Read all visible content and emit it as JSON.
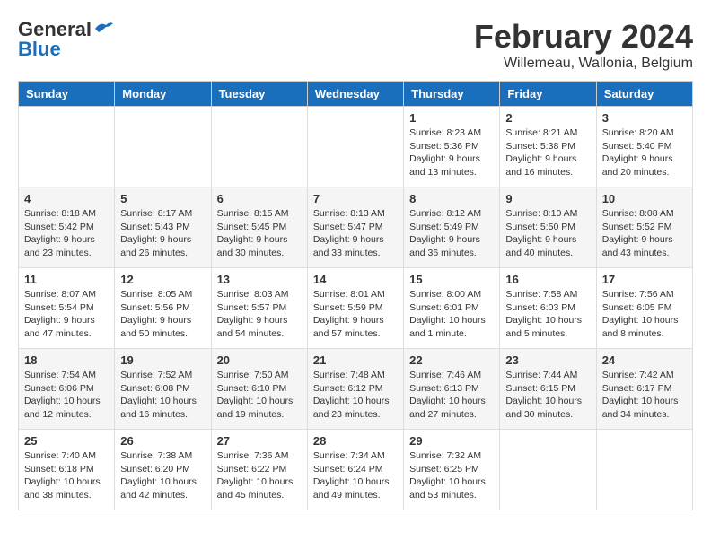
{
  "header": {
    "logo_general": "General",
    "logo_blue": "Blue",
    "month_title": "February 2024",
    "location": "Willemeau, Wallonia, Belgium"
  },
  "weekdays": [
    "Sunday",
    "Monday",
    "Tuesday",
    "Wednesday",
    "Thursday",
    "Friday",
    "Saturday"
  ],
  "weeks": [
    [
      {
        "day": "",
        "info": ""
      },
      {
        "day": "",
        "info": ""
      },
      {
        "day": "",
        "info": ""
      },
      {
        "day": "",
        "info": ""
      },
      {
        "day": "1",
        "info": "Sunrise: 8:23 AM\nSunset: 5:36 PM\nDaylight: 9 hours\nand 13 minutes."
      },
      {
        "day": "2",
        "info": "Sunrise: 8:21 AM\nSunset: 5:38 PM\nDaylight: 9 hours\nand 16 minutes."
      },
      {
        "day": "3",
        "info": "Sunrise: 8:20 AM\nSunset: 5:40 PM\nDaylight: 9 hours\nand 20 minutes."
      }
    ],
    [
      {
        "day": "4",
        "info": "Sunrise: 8:18 AM\nSunset: 5:42 PM\nDaylight: 9 hours\nand 23 minutes."
      },
      {
        "day": "5",
        "info": "Sunrise: 8:17 AM\nSunset: 5:43 PM\nDaylight: 9 hours\nand 26 minutes."
      },
      {
        "day": "6",
        "info": "Sunrise: 8:15 AM\nSunset: 5:45 PM\nDaylight: 9 hours\nand 30 minutes."
      },
      {
        "day": "7",
        "info": "Sunrise: 8:13 AM\nSunset: 5:47 PM\nDaylight: 9 hours\nand 33 minutes."
      },
      {
        "day": "8",
        "info": "Sunrise: 8:12 AM\nSunset: 5:49 PM\nDaylight: 9 hours\nand 36 minutes."
      },
      {
        "day": "9",
        "info": "Sunrise: 8:10 AM\nSunset: 5:50 PM\nDaylight: 9 hours\nand 40 minutes."
      },
      {
        "day": "10",
        "info": "Sunrise: 8:08 AM\nSunset: 5:52 PM\nDaylight: 9 hours\nand 43 minutes."
      }
    ],
    [
      {
        "day": "11",
        "info": "Sunrise: 8:07 AM\nSunset: 5:54 PM\nDaylight: 9 hours\nand 47 minutes."
      },
      {
        "day": "12",
        "info": "Sunrise: 8:05 AM\nSunset: 5:56 PM\nDaylight: 9 hours\nand 50 minutes."
      },
      {
        "day": "13",
        "info": "Sunrise: 8:03 AM\nSunset: 5:57 PM\nDaylight: 9 hours\nand 54 minutes."
      },
      {
        "day": "14",
        "info": "Sunrise: 8:01 AM\nSunset: 5:59 PM\nDaylight: 9 hours\nand 57 minutes."
      },
      {
        "day": "15",
        "info": "Sunrise: 8:00 AM\nSunset: 6:01 PM\nDaylight: 10 hours\nand 1 minute."
      },
      {
        "day": "16",
        "info": "Sunrise: 7:58 AM\nSunset: 6:03 PM\nDaylight: 10 hours\nand 5 minutes."
      },
      {
        "day": "17",
        "info": "Sunrise: 7:56 AM\nSunset: 6:05 PM\nDaylight: 10 hours\nand 8 minutes."
      }
    ],
    [
      {
        "day": "18",
        "info": "Sunrise: 7:54 AM\nSunset: 6:06 PM\nDaylight: 10 hours\nand 12 minutes."
      },
      {
        "day": "19",
        "info": "Sunrise: 7:52 AM\nSunset: 6:08 PM\nDaylight: 10 hours\nand 16 minutes."
      },
      {
        "day": "20",
        "info": "Sunrise: 7:50 AM\nSunset: 6:10 PM\nDaylight: 10 hours\nand 19 minutes."
      },
      {
        "day": "21",
        "info": "Sunrise: 7:48 AM\nSunset: 6:12 PM\nDaylight: 10 hours\nand 23 minutes."
      },
      {
        "day": "22",
        "info": "Sunrise: 7:46 AM\nSunset: 6:13 PM\nDaylight: 10 hours\nand 27 minutes."
      },
      {
        "day": "23",
        "info": "Sunrise: 7:44 AM\nSunset: 6:15 PM\nDaylight: 10 hours\nand 30 minutes."
      },
      {
        "day": "24",
        "info": "Sunrise: 7:42 AM\nSunset: 6:17 PM\nDaylight: 10 hours\nand 34 minutes."
      }
    ],
    [
      {
        "day": "25",
        "info": "Sunrise: 7:40 AM\nSunset: 6:18 PM\nDaylight: 10 hours\nand 38 minutes."
      },
      {
        "day": "26",
        "info": "Sunrise: 7:38 AM\nSunset: 6:20 PM\nDaylight: 10 hours\nand 42 minutes."
      },
      {
        "day": "27",
        "info": "Sunrise: 7:36 AM\nSunset: 6:22 PM\nDaylight: 10 hours\nand 45 minutes."
      },
      {
        "day": "28",
        "info": "Sunrise: 7:34 AM\nSunset: 6:24 PM\nDaylight: 10 hours\nand 49 minutes."
      },
      {
        "day": "29",
        "info": "Sunrise: 7:32 AM\nSunset: 6:25 PM\nDaylight: 10 hours\nand 53 minutes."
      },
      {
        "day": "",
        "info": ""
      },
      {
        "day": "",
        "info": ""
      }
    ]
  ]
}
